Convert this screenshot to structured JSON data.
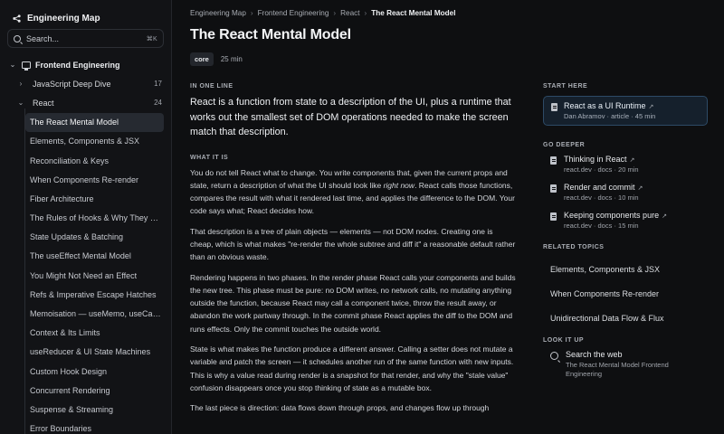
{
  "app": {
    "title": "Engineering Map"
  },
  "search": {
    "placeholder": "Search...",
    "shortcut": "⌘K"
  },
  "sidebar": {
    "section": {
      "label": "Frontend Engineering",
      "icon": "monitor-icon"
    },
    "groups": [
      {
        "label": "JavaScript Deep Dive",
        "count": "17"
      },
      {
        "label": "React",
        "count": "24"
      }
    ],
    "items": [
      "The React Mental Model",
      "Elements, Components & JSX",
      "Reconciliation & Keys",
      "When Components Re-render",
      "Fiber Architecture",
      "The Rules of Hooks & Why They Ex...",
      "State Updates & Batching",
      "The useEffect Mental Model",
      "You Might Not Need an Effect",
      "Refs & Imperative Escape Hatches",
      "Memoisation — useMemo, useCall...",
      "Context & Its Limits",
      "useReducer & UI State Machines",
      "Custom Hook Design",
      "Concurrent Rendering",
      "Suspense & Streaming",
      "Error Boundaries"
    ]
  },
  "breadcrumb": [
    "Engineering Map",
    "Frontend Engineering",
    "React",
    "The React Mental Model"
  ],
  "page": {
    "title": "The React Mental Model",
    "tag": "core",
    "duration": "25 min",
    "one_line_heading": "IN ONE LINE",
    "one_line": "React is a function from state to a description of the UI, plus a runtime that works out the smallest set of DOM operations needed to make the screen match that description.",
    "what_heading": "WHAT IT IS",
    "p1_a": "You do not tell React what to change. You write components that, given the current props and state, return a description of what the UI should look like ",
    "p1_em": "right now",
    "p1_b": ". React calls those functions, compares the result with what it rendered last time, and applies the difference to the DOM. Your code says what; React decides how.",
    "p2": "That description is a tree of plain objects — elements — not DOM nodes. Creating one is cheap, which is what makes \"re-render the whole subtree and diff it\" a reasonable default rather than an obvious waste.",
    "p3": "Rendering happens in two phases. In the render phase React calls your components and builds the new tree. This phase must be pure: no DOM writes, no network calls, no mutating anything outside the function, because React may call a component twice, throw the result away, or abandon the work partway through. In the commit phase React applies the diff to the DOM and runs effects. Only the commit touches the outside world.",
    "p4": "State is what makes the function produce a different answer. Calling a setter does not mutate a variable and patch the screen — it schedules another run of the same function with new inputs. This is why a value read during render is a snapshot for that render, and why the \"stale value\" confusion disappears once you stop thinking of state as a mutable box.",
    "p5": "The last piece is direction: data flows down through props, and changes flow up through"
  },
  "rail": {
    "start_heading": "START HERE",
    "start": {
      "title": "React as a UI Runtime",
      "sub": "Dan Abramov · article · 45 min"
    },
    "deeper_heading": "GO DEEPER",
    "deeper": [
      {
        "title": "Thinking in React",
        "sub": "react.dev · docs · 20 min"
      },
      {
        "title": "Render and commit",
        "sub": "react.dev · docs · 10 min"
      },
      {
        "title": "Keeping components pure",
        "sub": "react.dev · docs · 15 min"
      }
    ],
    "related_heading": "RELATED TOPICS",
    "related": [
      "Elements, Components & JSX",
      "When Components Re-render",
      "Unidirectional Data Flow & Flux"
    ],
    "lookup_heading": "LOOK IT UP",
    "lookup": {
      "title": "Search the web",
      "sub": "The React Mental Model Frontend Engineering"
    }
  },
  "colors": {
    "accent_border": "#2d4a66",
    "active_item": "#262a31"
  }
}
